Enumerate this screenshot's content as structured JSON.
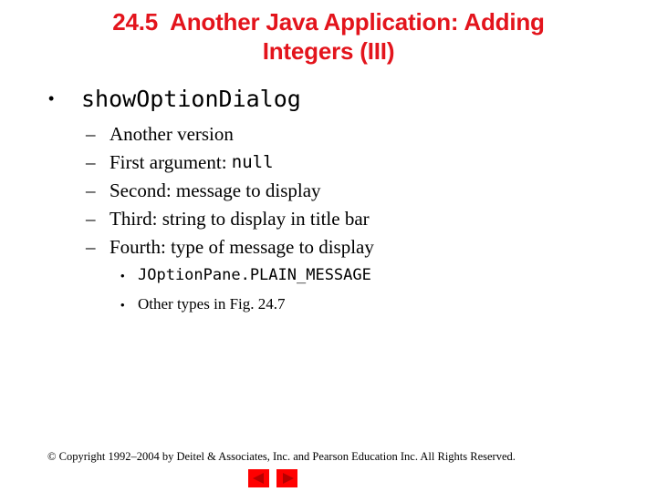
{
  "slide": {
    "title_lines": [
      "24.5  Another Java Application: Adding",
      "Integers (III)"
    ],
    "bullet": {
      "marker": "•",
      "text": "showOptionDialog",
      "sub_items": [
        {
          "marker": "–",
          "text": "Another version",
          "code": ""
        },
        {
          "marker": "–",
          "text": "First argument: ",
          "code": "null"
        },
        {
          "marker": "–",
          "text": "Second: message to display",
          "code": ""
        },
        {
          "marker": "–",
          "text": "Third: string to display in title bar",
          "code": ""
        },
        {
          "marker": "–",
          "text": "Fourth: type of message to display",
          "code": ""
        }
      ],
      "sub_sub_items": [
        {
          "marker": "•",
          "code": "JOption­Pane.PLAIN_MESSAGE",
          "text": ""
        },
        {
          "marker": "•",
          "code": "",
          "text": "Other types in Fig. 24.7"
        }
      ]
    },
    "footer": "© Copyright 1992–2004 by Deitel & Associates, Inc. and Pearson Education Inc. All Rights Reserved.",
    "nav": {
      "prev_icon": "left-triangle",
      "next_icon": "right-triangle"
    },
    "colors": {
      "title": "#e3141c",
      "nav_button": "#ff0000",
      "nav_arrow": "#b80000"
    }
  }
}
